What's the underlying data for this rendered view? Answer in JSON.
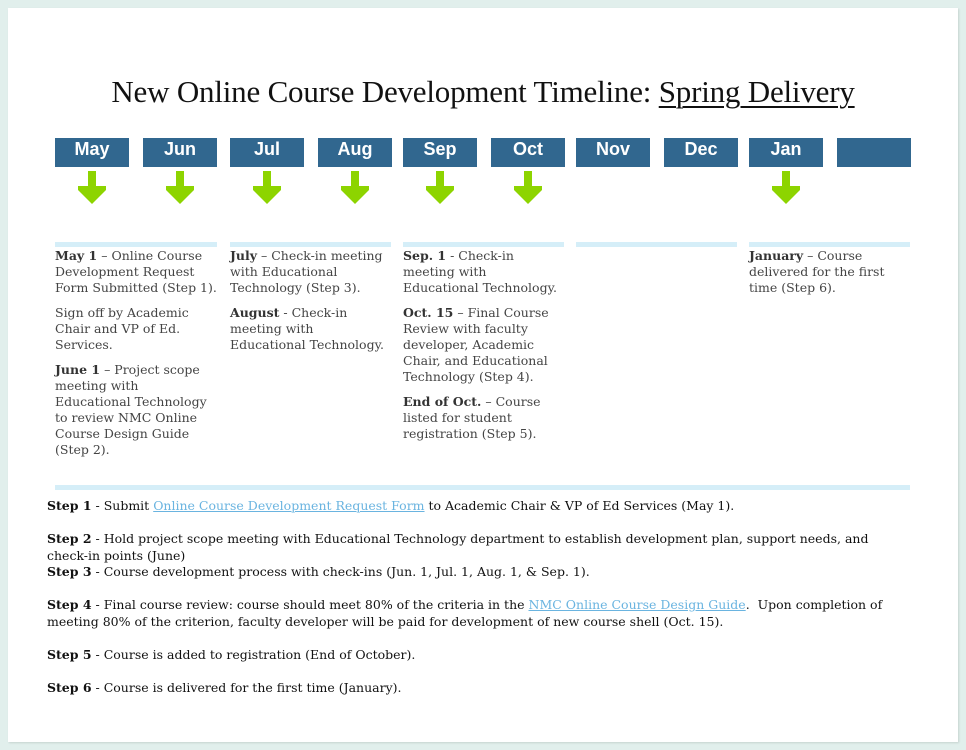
{
  "title": {
    "prefix": "New Online Course Development Timeline: ",
    "emphasis": "Spring Delivery"
  },
  "colors": {
    "month_box": "#31678f",
    "arrow": "#8dd400",
    "rule": "#d5eef8",
    "link": "#6ab4e0",
    "page_bg": "#e1efec"
  },
  "months": [
    {
      "label": "May",
      "arrow": true
    },
    {
      "label": "Jun",
      "arrow": true
    },
    {
      "label": "Jul",
      "arrow": true
    },
    {
      "label": "Aug",
      "arrow": true
    },
    {
      "label": "Sep",
      "arrow": true
    },
    {
      "label": "Oct",
      "arrow": true
    },
    {
      "label": "Nov",
      "arrow": false
    },
    {
      "label": "Dec",
      "arrow": false
    },
    {
      "label": "Jan",
      "arrow": true
    },
    {
      "label": "",
      "arrow": false
    }
  ],
  "columns": [
    {
      "entries": [
        {
          "bold": "May 1",
          "text": " – Online Course Development Request Form Submitted (Step 1)."
        },
        {
          "bold": "",
          "text": "Sign off by Academic Chair and VP of Ed. Services."
        },
        {
          "bold": "June 1",
          "text": " – Project scope meeting with Educational Technology to review NMC Online Course Design Guide (Step 2)."
        }
      ]
    },
    {
      "entries": [
        {
          "bold": "July",
          "text": " – Check-in meeting with Educational Technology (Step 3)."
        },
        {
          "bold": "August",
          "text": " - Check-in meeting with Educational Technology."
        }
      ]
    },
    {
      "entries": [
        {
          "bold": "Sep. 1",
          "text": " - Check-in meeting with Educational Technology."
        },
        {
          "bold": "Oct. 15",
          "text": " – Final Course Review with faculty developer, Academic Chair, and Educational Technology (Step 4)."
        },
        {
          "bold": "End of Oct.",
          "text": " – Course listed for student registration (Step 5)."
        }
      ]
    },
    {
      "entries": []
    },
    {
      "entries": [
        {
          "bold": "January",
          "text": " – Course delivered for the first time (Step 6)."
        }
      ]
    }
  ],
  "steps": [
    {
      "label": "Step 1",
      "before": " - Submit ",
      "link": "Online Course Development Request Form",
      "after": " to Academic Chair & VP of Ed Services (May 1)."
    },
    {
      "label": "Step 2",
      "before": " - Hold project scope meeting with Educational Technology department to establish development plan, support needs, and check-in points (June)",
      "link": "",
      "after": ""
    },
    {
      "label": "Step 3",
      "before": " - Course development process with check-ins (Jun. 1, Jul. 1, Aug. 1, & Sep. 1).",
      "link": "",
      "after": ""
    },
    {
      "label": "Step 4",
      "before": " - Final course review: course should meet 80% of the criteria in the ",
      "link": "NMC Online Course Design Guide",
      "after": ".  Upon completion of meeting 80% of the criterion, faculty developer will be paid for development of new course shell (Oct. 15)."
    },
    {
      "label": "Step 5",
      "before": " - Course is added to registration (End of October).",
      "link": "",
      "after": ""
    },
    {
      "label": "Step 6",
      "before": " - Course is delivered for the first time (January).",
      "link": "",
      "after": ""
    }
  ]
}
